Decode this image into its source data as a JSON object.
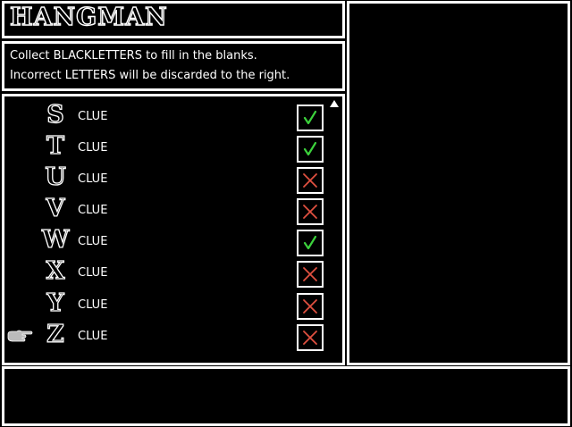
{
  "title": "HANGMAN",
  "instructions": [
    "Collect BLACKLETTERS to fill in the blanks.",
    "Incorrect LETTERS will be discarded to the right."
  ],
  "rows": [
    {
      "letter": "S",
      "clue": "CLUE",
      "status": "correct"
    },
    {
      "letter": "T",
      "clue": "CLUE",
      "status": "correct"
    },
    {
      "letter": "U",
      "clue": "CLUE",
      "status": "wrong"
    },
    {
      "letter": "V",
      "clue": "CLUE",
      "status": "wrong"
    },
    {
      "letter": "W",
      "clue": "CLUE",
      "status": "correct"
    },
    {
      "letter": "X",
      "clue": "CLUE",
      "status": "wrong"
    },
    {
      "letter": "Y",
      "clue": "CLUE",
      "status": "wrong"
    },
    {
      "letter": "Z",
      "clue": "CLUE",
      "status": "wrong"
    }
  ],
  "selected_row": 7,
  "colors": {
    "correct": "#3cd23c",
    "wrong": "#e05040",
    "panel_border": "#ffffff",
    "background": "#000000"
  },
  "icons": {
    "pointer": "pointing-hand-icon",
    "correct": "checkmark-icon",
    "wrong": "x-mark-icon",
    "scroll": "scroll-up-arrow-icon"
  }
}
